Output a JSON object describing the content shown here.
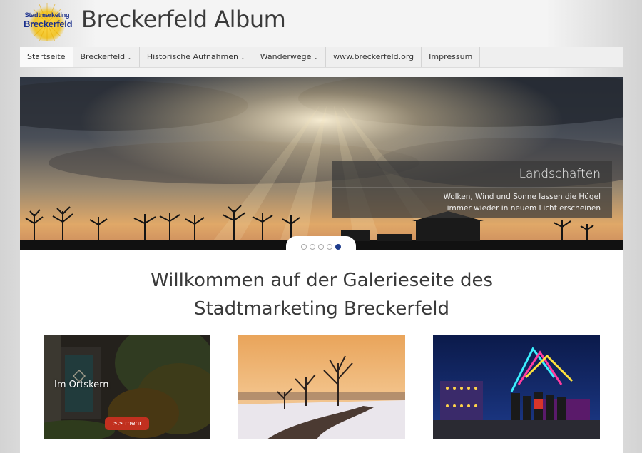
{
  "header": {
    "logo_line1": "Stadtmarketing",
    "logo_line2": "Breckerfeld",
    "site_title": "Breckerfeld Album"
  },
  "nav": {
    "items": [
      {
        "label": "Startseite",
        "active": true,
        "has_dropdown": false
      },
      {
        "label": "Breckerfeld",
        "active": false,
        "has_dropdown": true
      },
      {
        "label": "Historische Aufnahmen",
        "active": false,
        "has_dropdown": true
      },
      {
        "label": "Wanderwege",
        "active": false,
        "has_dropdown": true
      },
      {
        "label": "www.breckerfeld.org",
        "active": false,
        "has_dropdown": false
      },
      {
        "label": "Impressum",
        "active": false,
        "has_dropdown": false
      }
    ],
    "dropdown_icon": "chevron-down-icon"
  },
  "slider": {
    "caption_title": "Landschaften",
    "caption_line1": "Wolken, Wind und Sonne lassen die Hügel",
    "caption_line2": "immer wieder in neuem Licht erscheinen",
    "dot_count": 5,
    "active_dot": 5
  },
  "welcome": {
    "line1": "Willkommen auf der Galerieseite des",
    "line2": "Stadtmarketing Breckerfeld"
  },
  "cards": [
    {
      "title": "Im Ortskern",
      "button": ">> mehr"
    },
    {
      "title": "",
      "button": ""
    },
    {
      "title": "",
      "button": ""
    }
  ],
  "colors": {
    "logo_blue": "#1a2f8c",
    "logo_gold": "#f2c21b",
    "button_red": "#c1301f",
    "active_dot": "#1e3c8c"
  }
}
